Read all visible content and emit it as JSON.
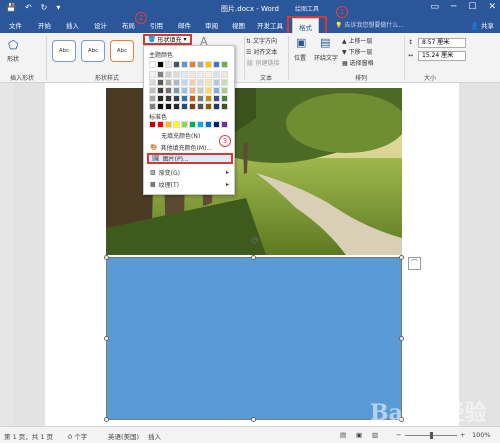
{
  "app": {
    "title": "图片.docx - Word",
    "context_tools_label": "绘图工具",
    "window_controls": [
      "▭",
      "─",
      "☐",
      "✕"
    ],
    "qat_icons": [
      "save-icon",
      "undo-icon",
      "redo-icon",
      "customize-icon"
    ]
  },
  "tabs": [
    {
      "label": "文件",
      "active": false
    },
    {
      "label": "开始",
      "active": false
    },
    {
      "label": "插入",
      "active": false
    },
    {
      "label": "设计",
      "active": false
    },
    {
      "label": "布局",
      "active": false
    },
    {
      "label": "引用",
      "active": false
    },
    {
      "label": "邮件",
      "active": false
    },
    {
      "label": "审阅",
      "active": false
    },
    {
      "label": "视图",
      "active": false
    },
    {
      "label": "开发工具",
      "active": false
    },
    {
      "label": "格式",
      "active": true
    }
  ],
  "tellme": "告诉我您想要做什么...",
  "share": "共享",
  "ribbon": {
    "shapes_label": "形状",
    "insert_shapes_group": "插入形状",
    "shape_styles_group": "形状样式",
    "style_samples": [
      "Abc",
      "Abc",
      "Abc"
    ],
    "shape_fill_button": "形状填充",
    "text_group": "文本",
    "text_direction": "文字方向",
    "align_text": "对齐文本",
    "create_link": "创建链接",
    "arrange_group": "排列",
    "position": "位置",
    "wrap_text": "环绕文字",
    "bring_forward": "上移一层",
    "send_backward": "下移一层",
    "selection_pane": "选择窗格",
    "size_group": "大小",
    "height_value": "8.57 厘米",
    "width_value": "15.24 厘米"
  },
  "fill_menu": {
    "theme_colors_label": "主题颜色",
    "theme_colors": [
      [
        "#ffffff",
        "#000000",
        "#e7e6e6",
        "#44546a",
        "#5b9bd5",
        "#ed7d31",
        "#a5a5a5",
        "#ffc000",
        "#4472c4",
        "#70ad47"
      ],
      [
        "#f2f2f2",
        "#7f7f7f",
        "#d0cece",
        "#d6dce4",
        "#deebf6",
        "#fbe5d5",
        "#ededed",
        "#fff2cc",
        "#d9e2f3",
        "#e2efd9"
      ],
      [
        "#d8d8d8",
        "#595959",
        "#aeabab",
        "#adb9ca",
        "#bdd7ee",
        "#f7cbac",
        "#dbdbdb",
        "#fee599",
        "#b4c6e7",
        "#c5e0b3"
      ],
      [
        "#bfbfbf",
        "#3f3f3f",
        "#757070",
        "#8496b0",
        "#9cc3e5",
        "#f4b183",
        "#c9c9c9",
        "#ffd965",
        "#8eaadb",
        "#a8d08d"
      ],
      [
        "#a5a5a5",
        "#262626",
        "#3a3838",
        "#323f4f",
        "#2e75b5",
        "#c55a11",
        "#7b7b7b",
        "#bf9000",
        "#2f5496",
        "#538135"
      ],
      [
        "#7f7f7f",
        "#0c0c0c",
        "#171616",
        "#222a35",
        "#1e4e79",
        "#833c0b",
        "#525252",
        "#7f6000",
        "#1f3864",
        "#375623"
      ]
    ],
    "standard_colors_label": "标准色",
    "standard_colors": [
      "#c00000",
      "#ff0000",
      "#ffc000",
      "#ffff00",
      "#92d050",
      "#00b050",
      "#00b0f0",
      "#0070c0",
      "#002060",
      "#7030a0"
    ],
    "no_fill": "无填充颜色(N)",
    "more_colors": "其他填充颜色(M)...",
    "picture": "图片(P)...",
    "gradient": "渐变(G)",
    "texture": "纹理(T)"
  },
  "markers": [
    "1",
    "2",
    "3"
  ],
  "status": {
    "page": "第 1 页，共 1 页",
    "words": "0 个字",
    "language": "英语(美国)",
    "insert_mode": "插入",
    "zoom": "100%"
  },
  "colors": {
    "word_blue": "#2b579a",
    "shape_fill": "#5b9bd5",
    "highlight_red": "#d93831"
  },
  "watermark": "Baidu经验"
}
